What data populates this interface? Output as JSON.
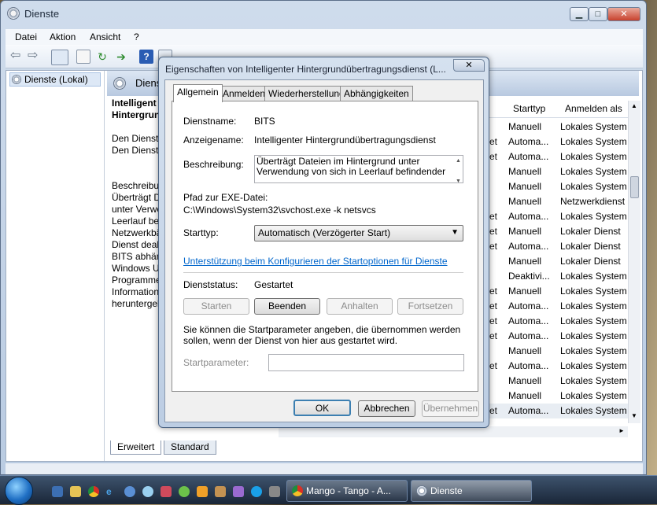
{
  "main_window": {
    "title": "Dienste",
    "menu": [
      "Datei",
      "Aktion",
      "Ansicht",
      "?"
    ],
    "tree_root": "Dienste (Lokal)",
    "header_label": "Dienste",
    "desc_lines": [
      "Intelligent",
      "Hintergrun",
      "",
      "Den Dienst",
      "Den Dienst",
      "",
      "",
      "Beschreibur",
      "Überträgt D",
      "unter Verwe",
      "Leerlauf bef",
      "Netzwerkbä",
      "Dienst deak",
      "BITS abhän",
      "Windows U",
      "Programme",
      "Information",
      "heruntergel"
    ],
    "columns": {
      "starttyp": "Starttyp",
      "anmelden": "Anmelden als"
    },
    "rows": [
      {
        "name": "",
        "start": "Manuell",
        "logon": "Lokales System"
      },
      {
        "name": "et",
        "start": "Automa...",
        "logon": "Lokales System"
      },
      {
        "name": "et",
        "start": "Automa...",
        "logon": "Lokales System"
      },
      {
        "name": "",
        "start": "Manuell",
        "logon": "Lokales System"
      },
      {
        "name": "",
        "start": "Manuell",
        "logon": "Lokales System"
      },
      {
        "name": "",
        "start": "Manuell",
        "logon": "Netzwerkdienst"
      },
      {
        "name": "et",
        "start": "Automa...",
        "logon": "Lokales System"
      },
      {
        "name": "et",
        "start": "Manuell",
        "logon": "Lokaler Dienst"
      },
      {
        "name": "et",
        "start": "Automa...",
        "logon": "Lokaler Dienst"
      },
      {
        "name": "",
        "start": "Manuell",
        "logon": "Lokaler Dienst"
      },
      {
        "name": "",
        "start": "Deaktivi...",
        "logon": "Lokales System"
      },
      {
        "name": "et",
        "start": "Manuell",
        "logon": "Lokales System"
      },
      {
        "name": "et",
        "start": "Automa...",
        "logon": "Lokales System"
      },
      {
        "name": "et",
        "start": "Automa...",
        "logon": "Lokales System"
      },
      {
        "name": "et",
        "start": "Automa...",
        "logon": "Lokales System"
      },
      {
        "name": "",
        "start": "Manuell",
        "logon": "Lokales System"
      },
      {
        "name": "et",
        "start": "Automa...",
        "logon": "Lokales System"
      },
      {
        "name": "",
        "start": "Manuell",
        "logon": "Lokales System"
      },
      {
        "name": "",
        "start": "Manuell",
        "logon": "Lokales System"
      },
      {
        "name": "et",
        "start": "Automa...",
        "logon": "Lokales System"
      }
    ],
    "bottom_tabs": [
      "Erweitert",
      "Standard"
    ]
  },
  "dialog": {
    "title": "Eigenschaften von Intelligenter Hintergrundübertragungsdienst (L...",
    "close": "✕",
    "tabs": [
      "Allgemein",
      "Anmelden",
      "Wiederherstellung",
      "Abhängigkeiten"
    ],
    "service_name_label": "Dienstname:",
    "service_name": "BITS",
    "display_name_label": "Anzeigename:",
    "display_name": "Intelligenter Hintergrundübertragungsdienst",
    "description_label": "Beschreibung:",
    "description": "Überträgt Dateien im Hintergrund unter Verwendung von sich in Leerlauf befindender",
    "path_label": "Pfad zur EXE-Datei:",
    "path": "C:\\Windows\\System32\\svchost.exe -k netsvcs",
    "starttype_label": "Starttyp:",
    "starttype_value": "Automatisch (Verzögerter Start)",
    "help_link": "Unterstützung beim Konfigurieren der Startoptionen für Dienste",
    "status_label": "Dienststatus:",
    "status_value": "Gestartet",
    "btn_start": "Starten",
    "btn_stop": "Beenden",
    "btn_pause": "Anhalten",
    "btn_resume": "Fortsetzen",
    "param_hint": "Sie können die Startparameter angeben, die übernommen werden sollen, wenn der Dienst von hier aus gestartet wird.",
    "param_label": "Startparameter:",
    "ok": "OK",
    "cancel": "Abbrechen",
    "apply": "Übernehmen"
  },
  "taskbar": {
    "tasks": [
      {
        "label": "Mango - Tango - A..."
      },
      {
        "label": "Dienste"
      }
    ]
  }
}
